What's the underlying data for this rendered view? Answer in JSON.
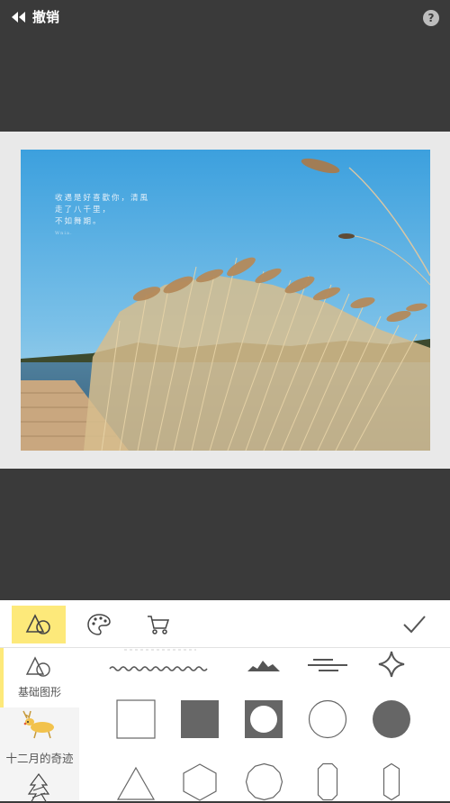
{
  "topbar": {
    "undo_label": "撤销",
    "help_label": "?"
  },
  "photo": {
    "poem_lines": [
      "收遇是好喜歡你，清風",
      "走了八千里，",
      "不如舞期。"
    ],
    "signature": "Wnia."
  },
  "toolbar": {
    "tabs": [
      {
        "icon": "shapes-icon",
        "active": true
      },
      {
        "icon": "palette-icon",
        "active": false
      },
      {
        "icon": "cart-icon",
        "active": false
      }
    ],
    "confirm_icon": "checkmark-icon"
  },
  "categories": [
    {
      "label": "基础图形",
      "icon": "shapes-icon",
      "active": true
    },
    {
      "label": "十二月的奇迹",
      "icon": "reindeer-icon",
      "active": false
    },
    {
      "label": "",
      "icon": "christmas-tree-icon",
      "active": false
    }
  ],
  "shape_rows": [
    [
      "wavy-line",
      "mountain-line",
      "dash-lines",
      "four-point-star"
    ],
    [
      "square-outline",
      "square-filled",
      "circle-in-square",
      "circle-outline",
      "circle-filled"
    ],
    [
      "triangle-outline",
      "hexagon-outline",
      "dodecagon-outline",
      "tall-octagon-outline",
      "tall-hexagon-outline"
    ]
  ],
  "colors": {
    "accent": "#fde97a",
    "editor_bg": "#3a3a3a",
    "shape_fill": "#666666"
  }
}
